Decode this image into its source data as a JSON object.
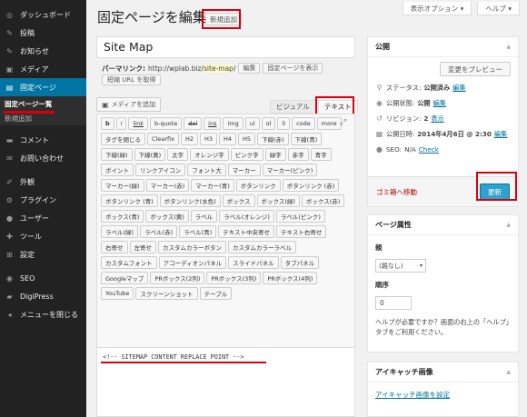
{
  "sidebar": {
    "items": [
      {
        "label": "ダッシュボード",
        "icon": "dashboard-icon",
        "glyph": "◎"
      },
      {
        "label": "投稿",
        "icon": "pin-icon",
        "glyph": "✎"
      },
      {
        "label": "お知らせ",
        "icon": "pin-icon",
        "glyph": "✎"
      },
      {
        "label": "メディア",
        "icon": "media-icon",
        "glyph": "▣"
      },
      {
        "label": "固定ページ",
        "icon": "page-icon",
        "glyph": "▤"
      }
    ],
    "sub": [
      "固定ページ一覧",
      "新規追加"
    ],
    "items2": [
      {
        "label": "コメント",
        "icon": "comment-icon",
        "glyph": "▬"
      },
      {
        "label": "お問い合わせ",
        "icon": "mail-icon",
        "glyph": "✉"
      }
    ],
    "items3": [
      {
        "label": "外観",
        "icon": "brush-icon",
        "glyph": "✐"
      },
      {
        "label": "プラグイン",
        "icon": "plugin-icon",
        "glyph": "⚙"
      },
      {
        "label": "ユーザー",
        "icon": "user-icon",
        "glyph": "●"
      },
      {
        "label": "ツール",
        "icon": "tool-icon",
        "glyph": "✚"
      },
      {
        "label": "設定",
        "icon": "settings-icon",
        "glyph": "⊞"
      }
    ],
    "items4": [
      {
        "label": "SEO",
        "icon": "seo-icon",
        "glyph": "◉"
      },
      {
        "label": "DigiPress",
        "icon": "digipress-icon",
        "glyph": "▰"
      },
      {
        "label": "メニューを閉じる",
        "icon": "collapse-icon",
        "glyph": "◂"
      }
    ]
  },
  "top": {
    "screen_options": "表示オプション ▾",
    "help": "ヘルプ ▾"
  },
  "header": {
    "title": "固定ページを編集",
    "add_new": "新規追加"
  },
  "editor": {
    "title_value": "Site Map",
    "permalink_label": "パーマリンク:",
    "permalink_base": "http://wplab.biz/",
    "permalink_slug": "site-map",
    "permalink_trail": "/",
    "edit_btn": "編集",
    "view_btn": "固定ページを表示",
    "shortlink_btn": "短縮 URL を取得",
    "add_media": "メディアを追加",
    "tab_visual": "ビジュアル",
    "tab_text": "テキスト",
    "quicktags": [
      "b",
      "i",
      "link",
      "b-quote",
      "del",
      "ins",
      "img",
      "ul",
      "ol",
      "li",
      "code",
      "more",
      "タグを閉じる",
      "Clearfix",
      "H2",
      "H3",
      "H4",
      "H5",
      "下線(赤)",
      "下線(青)",
      "下線(緑)",
      "下線(黄)",
      "太字",
      "オレンジ字",
      "ピンク字",
      "緑字",
      "赤字",
      "青字",
      "ポイント",
      "リンクアイコン",
      "フォント大",
      "マーカー",
      "マーカー(ピンク)",
      "マーカー(緑)",
      "マーカー(赤)",
      "マーカー(青)",
      "ボタンリンク",
      "ボタンリンク (赤)",
      "ボタンリンク (青)",
      "ボタンリンク(水色)",
      "ボックス",
      "ボックス(緑)",
      "ボックス(赤)",
      "ボックス(青)",
      "ボックス(黄)",
      "ラベル",
      "ラベル(オレンジ)",
      "ラベル(ピンク)",
      "ラベル(緑)",
      "ラベル(赤)",
      "ラベル(青)",
      "テキスト中央寄せ",
      "テキスト右寄せ",
      "右寄せ",
      "左寄せ",
      "カスタムカラーボタン",
      "カスタムカラーラベル",
      "カスタムフォント",
      "アコーディオンパネル",
      "スライドパネル",
      "タブパネル",
      "Googleマップ",
      "PRボックス(2列)",
      "PRボックス(3列)",
      "PRボックス(4列)",
      "YouTube",
      "スクリーンショット",
      "テーブル"
    ],
    "content": "<!-- SITEMAP CONTENT REPLACE POINT -->"
  },
  "publish": {
    "heading": "公開",
    "preview": "変更をプレビュー",
    "status_label": "ステータス:",
    "status_value": "公開済み",
    "status_edit": "編集",
    "vis_label": "公開状態:",
    "vis_value": "公開",
    "vis_edit": "編集",
    "rev_label": "リビジョン:",
    "rev_value": "2",
    "rev_link": "表示",
    "date_label": "公開日時:",
    "date_value": "2014年4月6日 @ 2:30",
    "date_edit": "編集",
    "seo_label": "SEO:",
    "seo_value": "N/A",
    "seo_check": "Check",
    "trash": "ゴミ箱へ移動",
    "update": "更新"
  },
  "attrs": {
    "heading": "ページ属性",
    "parent_label": "親",
    "parent_value": "(親なし)",
    "order_label": "順序",
    "order_value": "0",
    "help": "ヘルプが必要ですか？画面の右上の「ヘルプ」タブをご利用ください。"
  },
  "thumb": {
    "heading": "アイキャッチ画像",
    "link": "アイキャッチ画像を設定"
  },
  "colors": {
    "accent": "#0074a2",
    "highlight": "#d8000c"
  }
}
